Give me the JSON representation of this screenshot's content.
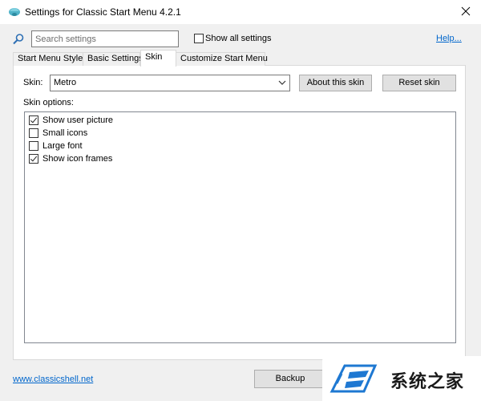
{
  "window": {
    "title": "Settings for Classic Start Menu 4.2.1",
    "close_icon": "close-icon",
    "app_icon": "shell-icon"
  },
  "search": {
    "placeholder": "Search settings",
    "value": "",
    "icon": "search-icon"
  },
  "show_all": {
    "label": "Show all settings",
    "checked": false
  },
  "help_link": "Help...",
  "tabs": [
    {
      "label": "Start Menu Style",
      "active": false
    },
    {
      "label": "Basic Settings",
      "active": false
    },
    {
      "label": "Skin",
      "active": true
    },
    {
      "label": "Customize Start Menu",
      "active": false
    }
  ],
  "skin": {
    "label": "Skin:",
    "selected": "Metro",
    "about_button": "About this skin",
    "reset_button": "Reset skin"
  },
  "skin_options": {
    "label": "Skin options:",
    "items": [
      {
        "label": "Show user picture",
        "checked": true
      },
      {
        "label": "Small icons",
        "checked": false
      },
      {
        "label": "Large font",
        "checked": false
      },
      {
        "label": "Show icon frames",
        "checked": true
      }
    ]
  },
  "footer": {
    "site_link": "www.classicshell.net",
    "backup_button": "Backup"
  },
  "watermark": {
    "text": "系统之家"
  },
  "colors": {
    "link": "#0066cc",
    "accent_logo": "#1e78d2"
  }
}
